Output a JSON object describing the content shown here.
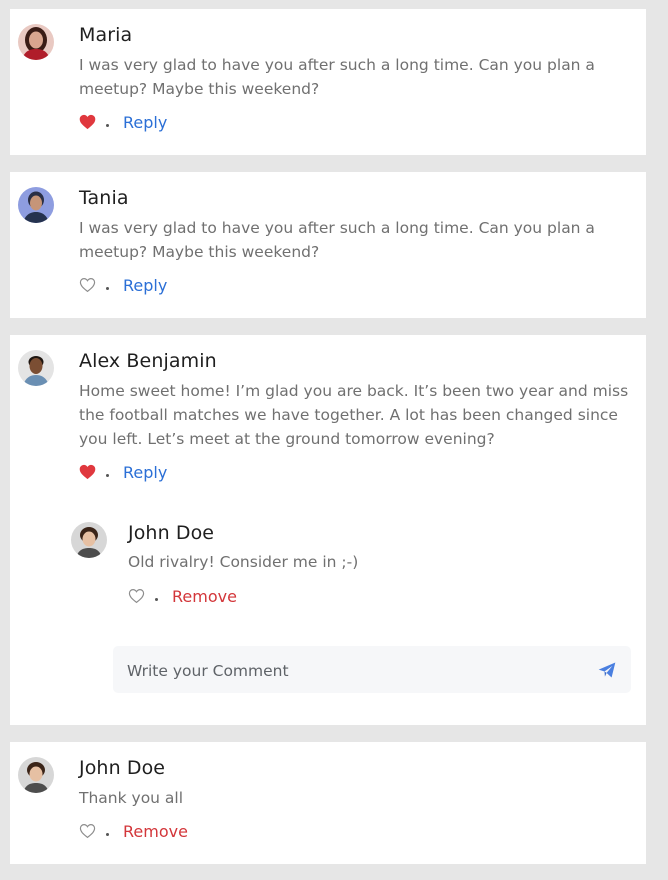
{
  "colors": {
    "page_bg": "#e6e6e6",
    "card_bg": "#ffffff",
    "liked_heart": "#e0383e",
    "reply_link": "#2b6fd6",
    "remove_link": "#d3363a",
    "send_icon": "#4a7fe0"
  },
  "comments": [
    {
      "name": "Maria",
      "avatar": "avatar-maria",
      "text": "I was very glad to have you after such a long time. Can you plan a meetup? Maybe this weekend?",
      "liked": true,
      "action": "Reply"
    },
    {
      "name": "Tania",
      "avatar": "avatar-tania",
      "text": "I was very glad to have you after such a long time. Can you plan a meetup? Maybe this weekend?",
      "liked": false,
      "action": "Reply"
    },
    {
      "name": "Alex Benjamin",
      "avatar": "avatar-alex",
      "text": "Home sweet home! I’m glad you are back. It’s been two year and miss the football matches we have together. A lot has been changed since you left. Let’s meet at the ground tomorrow evening?",
      "liked": true,
      "action": "Reply",
      "reply": {
        "name": "John Doe",
        "avatar": "avatar-john",
        "text": "Old rivalry! Consider me in ;-)",
        "liked": false,
        "action": "Remove"
      },
      "comment_input": {
        "placeholder": "Write your Comment",
        "value": ""
      }
    },
    {
      "name": "John Doe",
      "avatar": "avatar-john",
      "text": "Thank you all",
      "liked": false,
      "action": "Remove"
    }
  ]
}
